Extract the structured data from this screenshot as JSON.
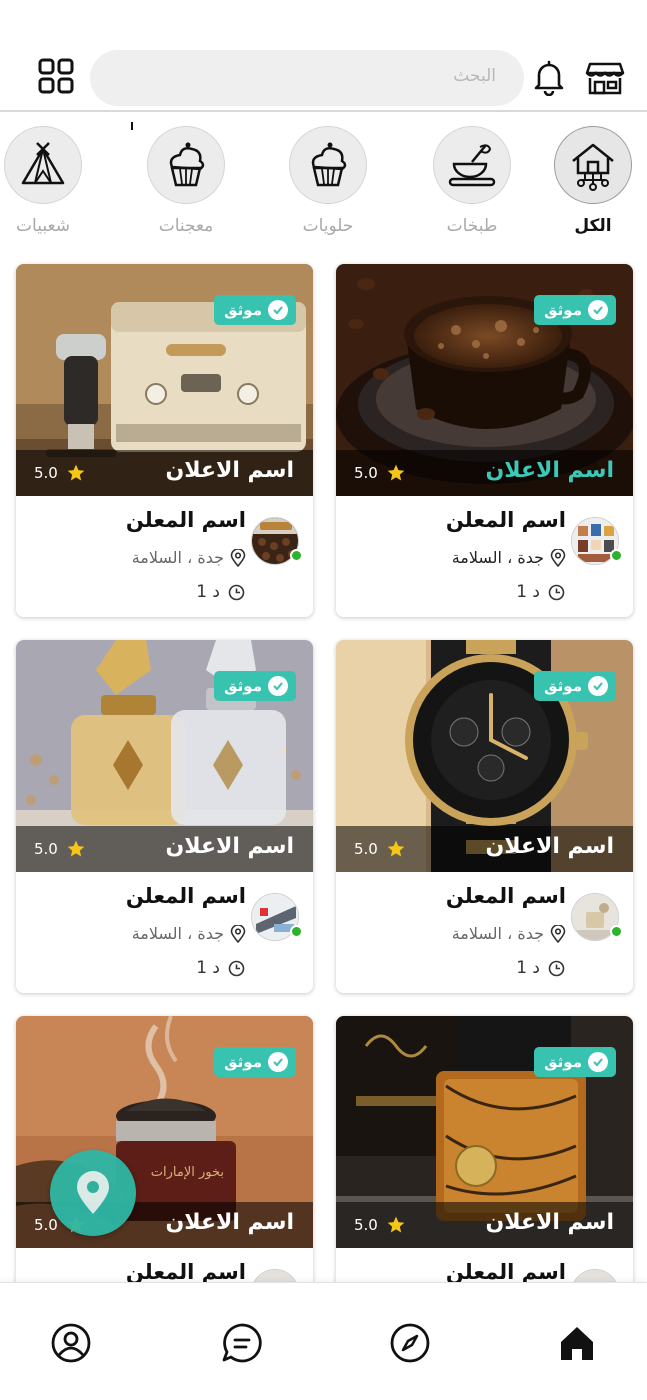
{
  "header": {
    "search_placeholder": "البحث",
    "icons": {
      "menu": "grid-icon",
      "notifications": "bell-icon",
      "store": "store-icon"
    }
  },
  "categories": [
    {
      "label": "الكل",
      "icon": "home-network-icon",
      "active": true
    },
    {
      "label": "طبخات",
      "icon": "mixing-bowl-icon",
      "active": false
    },
    {
      "label": "حلويات",
      "icon": "cupcake-icon",
      "active": false
    },
    {
      "label": "معجنات",
      "icon": "cupcake-icon",
      "active": false
    },
    {
      "label": "شعبيات",
      "icon": "tent-icon",
      "active": false
    }
  ],
  "listings": [
    {
      "badge": "موثق",
      "title": "اسم الاعلان",
      "rating": "5.0",
      "seller": "اسم المعلن",
      "location": "جدة ، السلامة",
      "time": "1 د",
      "image": "coffee-cup"
    },
    {
      "badge": "موثق",
      "title": "اسم الاعلان",
      "rating": "5.0",
      "seller": "اسم المعلن",
      "location": "جدة ، السلامة",
      "time": "1 د",
      "image": "espresso-machine"
    },
    {
      "badge": "موثق",
      "title": "اسم الاعلان",
      "rating": "5.0",
      "seller": "اسم المعلن",
      "location": "جدة ، السلامة",
      "time": "1 د",
      "image": "wristwatch"
    },
    {
      "badge": "موثق",
      "title": "اسم الاعلان",
      "rating": "5.0",
      "seller": "اسم المعلن",
      "location": "جدة ، السلامة",
      "time": "1 د",
      "image": "perfume-bottles"
    },
    {
      "badge": "موثق",
      "title": "اسم الاعلان",
      "rating": "5.0",
      "seller": "اسم المعلن",
      "image": "perfume-box"
    },
    {
      "badge": "موثق",
      "title": "اسم الاعلان",
      "rating": "5.0",
      "seller": "اسم المعلن",
      "image": "incense-jar",
      "image_text": "بخور الإمارات"
    }
  ],
  "bottom_nav": [
    {
      "icon": "home-icon",
      "active": true
    },
    {
      "icon": "compass-icon",
      "active": false
    },
    {
      "icon": "chat-icon",
      "active": false
    },
    {
      "icon": "user-icon",
      "active": false
    }
  ],
  "colors": {
    "accent": "#38c2b0",
    "online": "#2bb42b",
    "star": "#f5c518"
  }
}
